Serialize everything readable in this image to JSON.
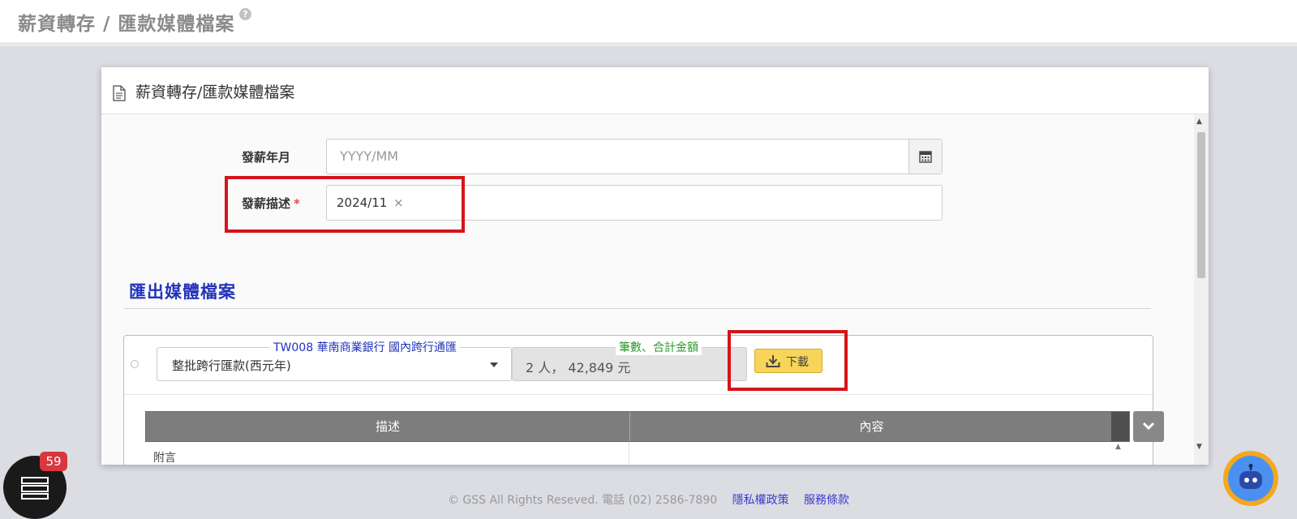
{
  "header": {
    "title": "薪資轉存 / 匯款媒體檔案",
    "help_icon": "?"
  },
  "panel": {
    "title": "薪資轉存/匯款媒體檔案",
    "form": {
      "pay_month": {
        "label": "發薪年月",
        "placeholder": "YYYY/MM"
      },
      "pay_desc": {
        "label": "發薪描述",
        "required_mark": "*",
        "tag": "2024/11",
        "tag_remove": "×"
      }
    },
    "export": {
      "section_title": "匯出媒體檔案",
      "bank_legend": "TW008 華南商業銀行 國內跨行通匯",
      "format_value": "整批跨行匯款(西元年)",
      "count_legend": "筆數、合計金額",
      "count_value": "2 人， 42,849 元",
      "download_label": "下載",
      "table": {
        "columns": [
          "描述",
          "內容"
        ],
        "first_row_partial": "附言"
      }
    }
  },
  "footer": {
    "copyright": "© GSS All Rights Reseved. 電話 (02) 2586-7890",
    "privacy_link": "隱私權政策",
    "terms_link": "服務條款"
  },
  "floating": {
    "notification_count": "59"
  }
}
